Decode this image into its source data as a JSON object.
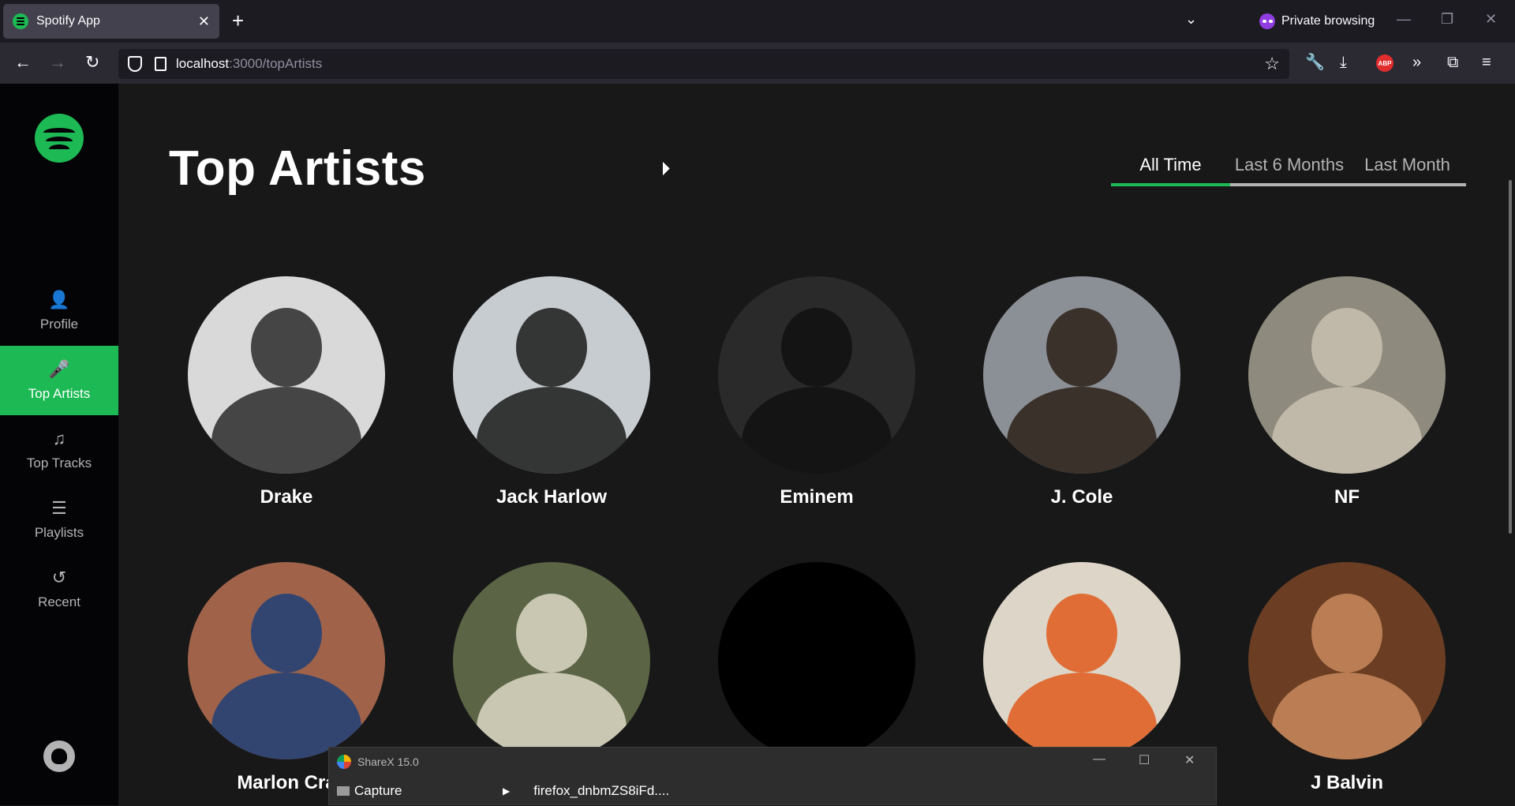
{
  "browser": {
    "tab_title": "Spotify App",
    "tab_close": "✕",
    "new_tab": "+",
    "tab_list": "⌄",
    "private_label": "Private browsing",
    "minimize": "—",
    "restore": "❐",
    "close": "✕",
    "url_host": "localhost",
    "url_path": ":3000/topArtists"
  },
  "sidebar": {
    "items": [
      {
        "label": "Profile",
        "icon": "👤"
      },
      {
        "label": "Top Artists",
        "icon": "🎤"
      },
      {
        "label": "Top Tracks",
        "icon": "♫"
      },
      {
        "label": "Playlists",
        "icon": "☰"
      },
      {
        "label": "Recent",
        "icon": "↺"
      }
    ],
    "accent": "#1db954"
  },
  "main": {
    "title": "Top Artists",
    "ranges": [
      {
        "label": "All Time",
        "active": true
      },
      {
        "label": "Last 6 Months",
        "active": false
      },
      {
        "label": "Last Month",
        "active": false
      }
    ],
    "artists": [
      {
        "name": "Drake",
        "bg": "#d9d9d9",
        "fg": "#2a2a2a"
      },
      {
        "name": "Jack Harlow",
        "bg": "#c7ccd1",
        "fg": "#1a1a1a"
      },
      {
        "name": "Eminem",
        "bg": "#2a2a2a",
        "fg": "#111111"
      },
      {
        "name": "J. Cole",
        "bg": "#8b8f96",
        "fg": "#2b2118"
      },
      {
        "name": "NF",
        "bg": "#8e8a7d",
        "fg": "#c9c1b1"
      },
      {
        "name": "Marlon Cra",
        "bg": "#a0634a",
        "fg": "#1f3f77"
      },
      {
        "name": "",
        "bg": "#5b6444",
        "fg": "#ddd8c5"
      },
      {
        "name": "",
        "bg": "#000000",
        "fg": "#000000"
      },
      {
        "name": "",
        "bg": "#ddd6c8",
        "fg": "#e15b1c"
      },
      {
        "name": "J Balvin",
        "bg": "#6b3e24",
        "fg": "#c98a5d"
      }
    ]
  },
  "sharex": {
    "title": "ShareX 15.0",
    "menu_item": "Capture",
    "file": "firefox_dnbmZS8iFd...."
  }
}
